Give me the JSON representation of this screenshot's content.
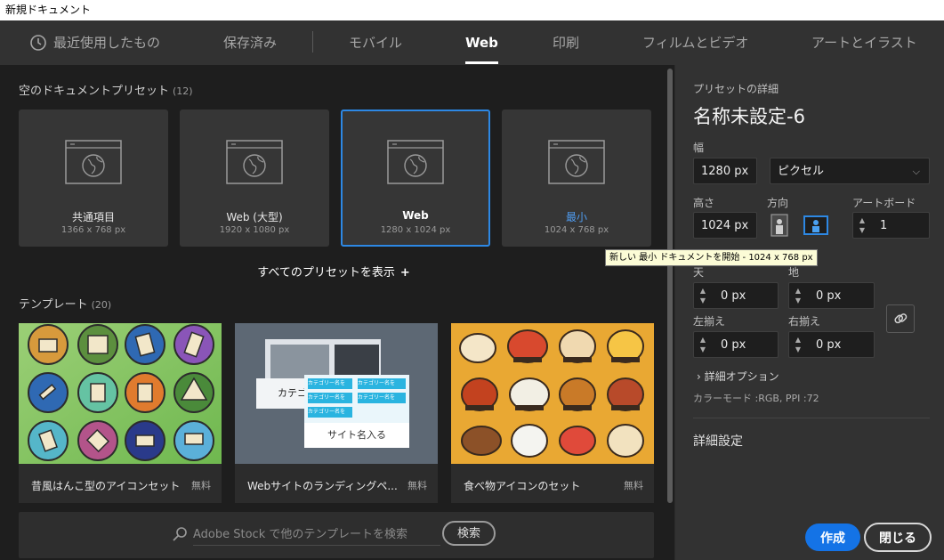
{
  "window": {
    "title": "新規ドキュメント"
  },
  "tabs": [
    {
      "label": "最近使用したもの",
      "icon": "clock-icon"
    },
    {
      "label": "保存済み"
    },
    {
      "label": "モバイル"
    },
    {
      "label": "Web",
      "active": true
    },
    {
      "label": "印刷"
    },
    {
      "label": "フィルムとビデオ"
    },
    {
      "label": "アートとイラスト"
    }
  ],
  "presets_section": {
    "title": "空のドキュメントプリセット",
    "count": "(12)",
    "items": [
      {
        "name": "共通項目",
        "size": "1366 x 768 px"
      },
      {
        "name": "Web (大型)",
        "size": "1920 x 1080 px"
      },
      {
        "name": "Web",
        "size": "1280 x 1024 px",
        "selected": true
      },
      {
        "name": "最小",
        "size": "1024 x 768 px",
        "hovered": true
      }
    ],
    "show_all": "すべてのプリセットを表示",
    "show_all_icon": "+"
  },
  "tooltip": "新しい 最小 ドキュメントを開始 - 1024 x 768 px",
  "templates_section": {
    "title": "テンプレート",
    "count": "(20)",
    "items": [
      {
        "name": "昔風はんこ型のアイコンセット",
        "badge": "無料"
      },
      {
        "name": "Webサイトのランディングペ...",
        "badge": "無料"
      },
      {
        "name": "食べ物アイコンのセット",
        "badge": "無料"
      }
    ],
    "thumb_texts": {
      "category_big": "カテゴ",
      "category_small": "カテゴリー名を",
      "site_name": "サイト名入る"
    }
  },
  "search": {
    "placeholder": "Adobe Stock で他のテンプレートを検索",
    "button": "検索"
  },
  "details": {
    "heading": "プリセットの詳細",
    "doc_name": "名称未設定-6",
    "width_label": "幅",
    "width_value": "1280 px",
    "unit_value": "ピクセル",
    "height_label": "高さ",
    "height_value": "1024 px",
    "orientation_label": "方向",
    "artboard_label": "アートボード",
    "artboard_value": "1",
    "top_label": "天",
    "top_value": "0 px",
    "bottom_label": "地",
    "bottom_value": "0 px",
    "left_label": "左揃え",
    "left_value": "0 px",
    "right_label": "右揃え",
    "right_value": "0 px",
    "advanced": "詳細オプション",
    "color_mode": "カラーモード :RGB, PPI :72",
    "detail_settings": "詳細設定"
  },
  "footer": {
    "create": "作成",
    "close": "閉じる"
  },
  "colors": {
    "accent": "#1473e6",
    "selected_border": "#2d88e4",
    "hover_text": "#4f9cf0"
  }
}
